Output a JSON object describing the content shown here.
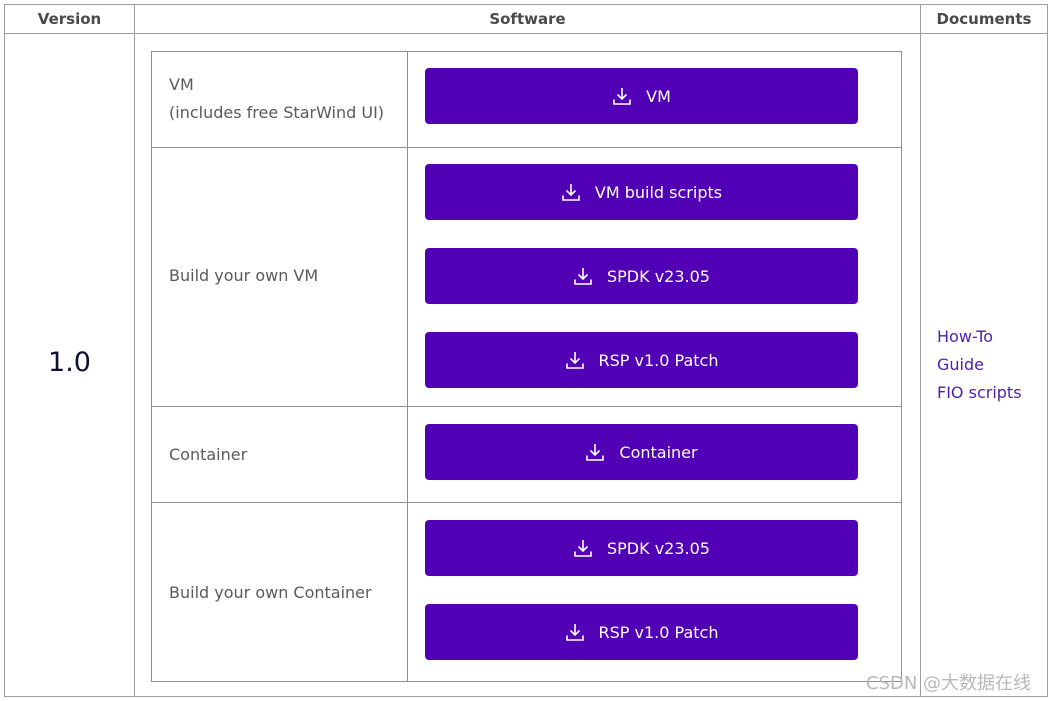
{
  "headers": {
    "version": "Version",
    "software": "Software",
    "documents": "Documents"
  },
  "version_value": "1.0",
  "rows": [
    {
      "label_line1": "VM",
      "label_line2": "(includes free StarWind UI)",
      "buttons": [
        "VM"
      ]
    },
    {
      "label_line1": "Build your own VM",
      "buttons": [
        "VM build scripts",
        "SPDK v23.05",
        "RSP v1.0 Patch"
      ]
    },
    {
      "label_line1": "Container",
      "buttons": [
        "Container"
      ]
    },
    {
      "label_line1": "Build your own Container",
      "buttons": [
        "SPDK v23.05",
        "RSP v1.0 Patch"
      ]
    }
  ],
  "documents": [
    "How-To",
    "Guide",
    "FIO scripts"
  ],
  "watermark": "CSDN @大数据在线",
  "colors": {
    "button_bg": "#5200b5",
    "link": "#4b1fb0",
    "border": "#9e9e9e"
  },
  "icons": {
    "download": "download-icon"
  }
}
